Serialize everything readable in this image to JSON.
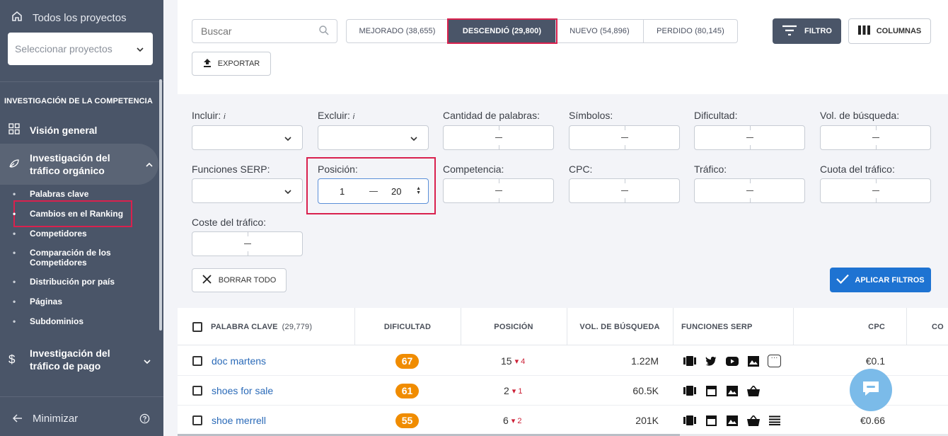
{
  "sidebar": {
    "all_projects": "Todos los proyectos",
    "select_projects": "Seleccionar proyectos",
    "section": "INVESTIGACIÓN DE LA COMPETENCIA",
    "overview": "Visión general",
    "organic": "Investigación del tráfico orgánico",
    "sub_items": [
      "Palabras clave",
      "Cambios en el Ranking",
      "Competidores",
      "Comparación de los Competidores",
      "Distribución por país",
      "Páginas",
      "Subdominios"
    ],
    "paid": "Investigación del tráfico de pago",
    "minimize": "Minimizar"
  },
  "toolbar": {
    "search_placeholder": "Buscar",
    "tabs": [
      "MEJORADO (38,655)",
      "DESCENDIÓ (29,800)",
      "NUEVO (54,896)",
      "PERDIDO (80,145)"
    ],
    "filter": "FILTRO",
    "columns": "COLUMNAS",
    "export": "EXPORTAR"
  },
  "filters": {
    "include": "Incluir:",
    "exclude": "Excluir:",
    "info": "i",
    "word_count": "Cantidad de palabras:",
    "symbols": "Símbolos:",
    "difficulty": "Dificultad:",
    "search_volume": "Vol. de búsqueda:",
    "serp_features": "Funciones SERP:",
    "position": "Posición:",
    "position_from": "1",
    "position_to": "20",
    "competition": "Competencia:",
    "cpc": "CPC:",
    "traffic": "Tráfico:",
    "traffic_share": "Cuota del tráfico:",
    "traffic_cost": "Coste del tráfico:",
    "clear_all": "BORRAR TODO",
    "apply": "APLICAR FILTROS"
  },
  "table": {
    "headers": {
      "keyword": "PALABRA CLAVE",
      "keyword_count": "(29,779)",
      "difficulty": "DIFICULTAD",
      "position": "POSICIÓN",
      "volume": "VOL. DE BÚSQUEDA",
      "serp": "FUNCIONES SERP",
      "cpc": "CPC",
      "next": "CO"
    },
    "rows": [
      {
        "keyword": "doc martens",
        "difficulty": "67",
        "position": "15",
        "change": "4",
        "volume": "1.22M",
        "cpc": "€0.1"
      },
      {
        "keyword": "shoes for sale",
        "difficulty": "61",
        "position": "2",
        "change": "1",
        "volume": "60.5K",
        "cpc": ""
      },
      {
        "keyword": "shoe merrell",
        "difficulty": "55",
        "position": "6",
        "change": "2",
        "volume": "201K",
        "cpc": "€0.66"
      }
    ],
    "change_arrow": "▾"
  },
  "colors": {
    "sidebar": "#4a5568",
    "accent": "#d9214e",
    "primary": "#1e73d2",
    "difficulty": "#f08c00"
  }
}
